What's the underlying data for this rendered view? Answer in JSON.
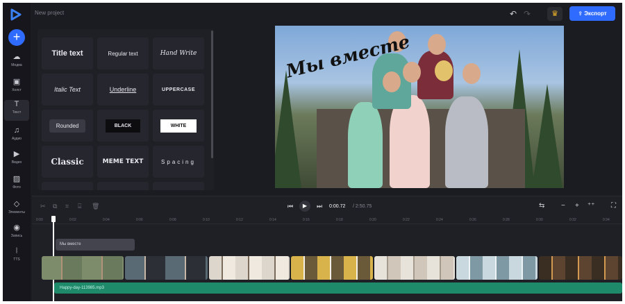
{
  "header": {
    "project_title": "New project",
    "export_label": "Экспорт"
  },
  "sidebar": {
    "items": [
      {
        "label": "Медиа",
        "icon": "cloud-upload-icon"
      },
      {
        "label": "Холст",
        "icon": "canvas-icon"
      },
      {
        "label": "Текст",
        "icon": "text-icon"
      },
      {
        "label": "Аудио",
        "icon": "music-icon"
      },
      {
        "label": "Видео",
        "icon": "video-icon"
      },
      {
        "label": "Фото",
        "icon": "photo-icon"
      },
      {
        "label": "Элементы",
        "icon": "shapes-icon"
      },
      {
        "label": "Запись",
        "icon": "record-icon"
      },
      {
        "label": "TTS",
        "icon": "tts-icon"
      }
    ]
  },
  "text_panel": {
    "styles": [
      "Title text",
      "Regular text",
      "Hand Write",
      "Italic Text",
      "Underline",
      "UPPERCASE",
      "Rounded",
      "BLACK",
      "WHITE",
      "Classic",
      "MEME TEXT",
      "Spacing"
    ]
  },
  "preview": {
    "overlay_text": "Мы вместе"
  },
  "timeline": {
    "current_time": "0:00.72",
    "total_time": "/ 2:50.75",
    "ruler_ticks": [
      "0:00",
      "0:02",
      "0:04",
      "0:06",
      "0:08",
      "0:10",
      "0:12",
      "0:14",
      "0:16",
      "0:18",
      "0:20",
      "0:22",
      "0:24",
      "0:26",
      "0:28",
      "0:30",
      "0:32",
      "0:34"
    ],
    "text_clip": "Мы вместе",
    "audio_clip": "Happy-day-113985.mp3"
  }
}
